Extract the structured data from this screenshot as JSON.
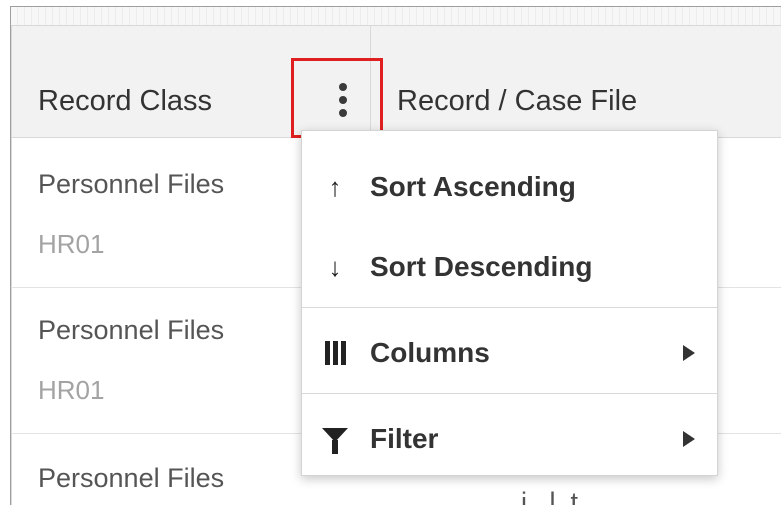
{
  "table": {
    "columns": [
      {
        "label": "Record Class"
      },
      {
        "label": "Record / Case File"
      }
    ],
    "rows": [
      {
        "record_class": "Personnel Files",
        "code": "HR01"
      },
      {
        "record_class": "Personnel Files",
        "code": "HR01"
      },
      {
        "record_class": "Personnel Files",
        "code": ""
      }
    ],
    "partial_cell_text": "i...l..t"
  },
  "column_menu": {
    "trigger_icon": "vertical-ellipsis-icon",
    "highlight_color": "#e02020",
    "items": [
      {
        "label": "Sort Ascending",
        "icon": "arrow-up-icon",
        "glyph": "↑",
        "submenu": false
      },
      {
        "label": "Sort Descending",
        "icon": "arrow-down-icon",
        "glyph": "↓",
        "submenu": false
      },
      {
        "label": "Columns",
        "icon": "columns-icon",
        "submenu": true
      },
      {
        "label": "Filter",
        "icon": "filter-icon",
        "submenu": true
      }
    ]
  }
}
